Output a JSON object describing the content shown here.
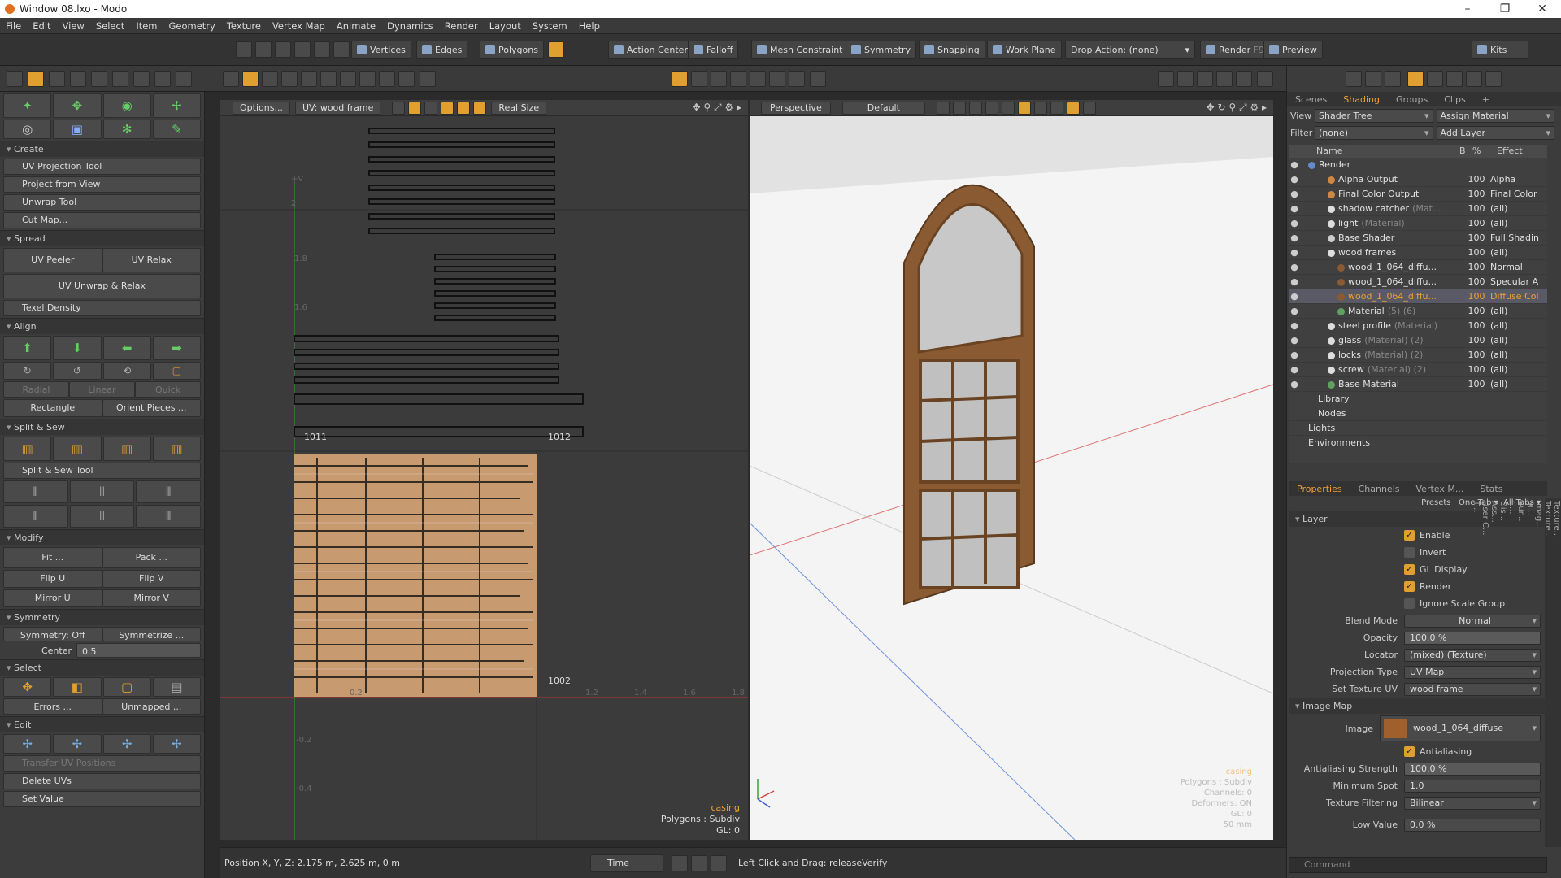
{
  "window": {
    "title": "Window 08.lxo - Modo",
    "min": "–",
    "max": "❐",
    "close": "✕"
  },
  "menu": [
    "File",
    "Edit",
    "View",
    "Select",
    "Item",
    "Geometry",
    "Texture",
    "Vertex Map",
    "Animate",
    "Dynamics",
    "Render",
    "Layout",
    "System",
    "Help"
  ],
  "toolbar": {
    "vertices": "Vertices",
    "edges": "Edges",
    "polygons": "Polygons",
    "action_center": "Action Center",
    "falloff": "Falloff",
    "mesh_constraint": "Mesh Constraint",
    "symmetry": "Symmetry",
    "snapping": "Snapping",
    "work_plane": "Work Plane",
    "drop_action": "Drop Action: (none)",
    "render": "Render",
    "render_key": "F9",
    "preview": "Preview",
    "kits": "Kits"
  },
  "left": {
    "create": "Create",
    "uv_projection_tool": "UV Projection Tool",
    "project_from_view": "Project from View",
    "unwrap_tool": "Unwrap Tool",
    "cut_map": "Cut Map...",
    "spread": "Spread",
    "uv_peeler": "UV Peeler",
    "uv_relax": "UV Relax",
    "uv_unwrap_relax": "UV Unwrap & Relax",
    "texel_density": "Texel Density",
    "align": "Align",
    "radial": "Radial",
    "linear": "Linear",
    "quick": "Quick",
    "rectangle": "Rectangle",
    "orient_pieces": "Orient Pieces ...",
    "split_sew": "Split & Sew",
    "split_sew_tool": "Split & Sew Tool",
    "modify": "Modify",
    "fit": "Fit ...",
    "pack": "Pack ...",
    "flip_u": "Flip U",
    "flip_v": "Flip V",
    "mirror_u": "Mirror U",
    "mirror_v": "Mirror V",
    "symmetry": "Symmetry",
    "symmetry_off": "Symmetry: Off",
    "symmetrize": "Symmetrize ...",
    "center_label": "Center",
    "center_value": "0.5",
    "select": "Select",
    "errors": "Errors ...",
    "unmapped": "Unmapped ...",
    "edit": "Edit",
    "transfer_uv": "Transfer UV Positions",
    "delete_uvs": "Delete UVs",
    "set_value": "Set Value"
  },
  "uv": {
    "options": "Options...",
    "uv_map": "UV: wood frame",
    "real_size": "Real Size",
    "tile_1011": "1011",
    "tile_1012": "1012",
    "tile_1002": "1002",
    "axis_v": "+V",
    "tick_2": "2",
    "tick_18": "1.8",
    "tick_16": "1.6",
    "tick_n02": "-0.2",
    "tick_n04": "-0.4",
    "tick_02": "0.2",
    "tick_12": "1.2",
    "tick_14": "1.4",
    "tick_16b": "1.6",
    "tick_18b": "1.8",
    "info_item": "casing",
    "info_poly": "Polygons : Subdiv",
    "info_gl": "GL: 0"
  },
  "viewport": {
    "perspective": "Perspective",
    "default": "Default",
    "info_item": "casing",
    "info_poly": "Polygons : Subdiv",
    "info_ch": "Channels: 0",
    "info_def": "Deformers: ON",
    "info_gl": "GL: 0",
    "info_mm": "50 mm"
  },
  "right": {
    "tabs": [
      "Scenes",
      "Shading",
      "Groups",
      "Clips"
    ],
    "view_label": "View",
    "view_value": "Shader Tree",
    "assign_material": "Assign Material",
    "filter_label": "Filter",
    "filter_value": "(none)",
    "add_layer": "Add Layer",
    "col_name": "Name",
    "col_b": "B",
    "col_pct": "%",
    "col_effect": "Effect",
    "tree": [
      {
        "name": "Render",
        "sub": "",
        "pct": "",
        "eff": ""
      },
      {
        "name": "Alpha Output",
        "sub": "",
        "pct": "100",
        "eff": "Alpha"
      },
      {
        "name": "Final Color Output",
        "sub": "",
        "pct": "100",
        "eff": "Final Color"
      },
      {
        "name": "shadow catcher",
        "sub": "(Mat...",
        "pct": "100",
        "eff": "(all)"
      },
      {
        "name": "light",
        "sub": "(Material)",
        "pct": "100",
        "eff": "(all)"
      },
      {
        "name": "Base Shader",
        "sub": "",
        "pct": "100",
        "eff": "Full Shading"
      },
      {
        "name": "wood frames",
        "sub": "",
        "pct": "100",
        "eff": "(all)"
      },
      {
        "name": "wood_1_064_diffu...",
        "sub": "",
        "pct": "100",
        "eff": "Normal"
      },
      {
        "name": "wood_1_064_diffu...",
        "sub": "",
        "pct": "100",
        "eff": "Specular Am"
      },
      {
        "name": "wood_1_064_diffu...",
        "sub": "",
        "pct": "100",
        "eff": "Diffuse Colo"
      },
      {
        "name": "Material",
        "sub": "(5) (6)",
        "pct": "100",
        "eff": "(all)"
      },
      {
        "name": "steel profile",
        "sub": "(Material)",
        "pct": "100",
        "eff": "(all)"
      },
      {
        "name": "glass",
        "sub": "(Material) (2)",
        "pct": "100",
        "eff": "(all)"
      },
      {
        "name": "locks",
        "sub": "(Material) (2)",
        "pct": "100",
        "eff": "(all)"
      },
      {
        "name": "screw",
        "sub": "(Material) (2)",
        "pct": "100",
        "eff": "(all)"
      },
      {
        "name": "Base Material",
        "sub": "",
        "pct": "100",
        "eff": "(all)"
      },
      {
        "name": "Library",
        "sub": "",
        "pct": "",
        "eff": ""
      },
      {
        "name": "Nodes",
        "sub": "",
        "pct": "",
        "eff": ""
      },
      {
        "name": "Lights",
        "sub": "",
        "pct": "",
        "eff": ""
      },
      {
        "name": "Environments",
        "sub": "",
        "pct": "",
        "eff": ""
      }
    ],
    "ptabs": [
      "Properties",
      "Channels",
      "Vertex M...",
      "Stats"
    ],
    "presets": "Presets",
    "one_tab": "One Tab",
    "all_tabs": "All Tabs",
    "layer": "Layer",
    "enable": "Enable",
    "invert": "Invert",
    "gl_display": "GL Display",
    "render": "Render",
    "ignore_scale": "Ignore Scale Group",
    "blend_mode": "Blend Mode",
    "blend_value": "Normal",
    "opacity": "Opacity",
    "opacity_value": "100.0 %",
    "locator": "Locator",
    "locator_value": "(mixed) (Texture)",
    "proj_type": "Projection Type",
    "proj_value": "UV Map",
    "set_tex_uv": "Set Texture UV",
    "set_tex_uv_value": "wood frame",
    "image_map": "Image Map",
    "image": "Image",
    "image_value": "wood_1_064_diffuse",
    "antialiasing": "Antialiasing",
    "aa_strength": "Antialiasing Strength",
    "aa_value": "100.0 %",
    "min_spot": "Minimum Spot",
    "min_spot_value": "1.0",
    "tex_filter": "Texture Filtering",
    "tex_filter_value": "Bilinear",
    "low_value": "Low Value",
    "low_value_value": "0.0 %",
    "vtabs": [
      "Texture...",
      "Texture...",
      "Imag...",
      "M...",
      "Sur...",
      "C...",
      "Dis...",
      "Ass...",
      "User C...",
      "T..."
    ],
    "command": "Command"
  },
  "status": {
    "position": "Position X, Y, Z:   2.175 m, 2.625 m, 0 m",
    "time": "Time",
    "hint": "Left Click and Drag:  releaseVerify"
  },
  "colors": {
    "accent": "#f0a030",
    "bg": "#3c3c3c",
    "viewport": "#d9d9d9"
  }
}
